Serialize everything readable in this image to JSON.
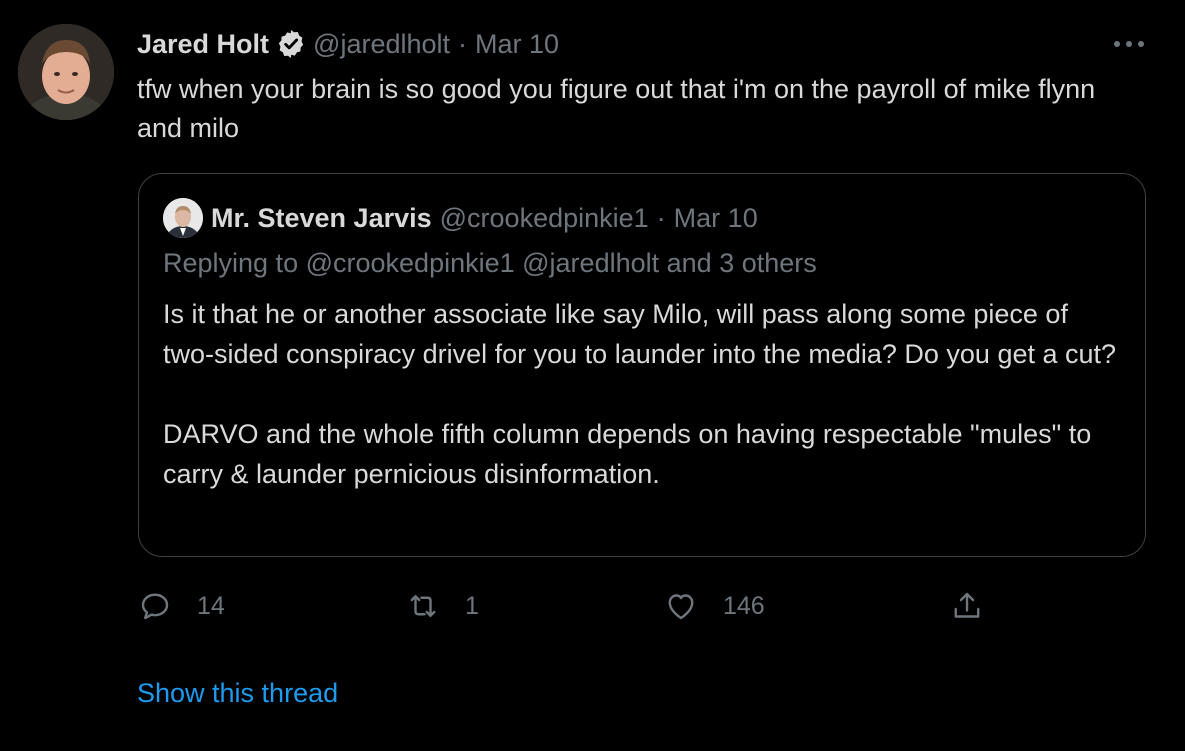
{
  "tweet": {
    "author": {
      "name": "Jared Holt",
      "handle": "@jaredlholt",
      "verified": true
    },
    "separator": "·",
    "date": "Mar 10",
    "text": "tfw when your brain is so good you figure out that i'm on the payroll of mike flynn and milo",
    "quoted": {
      "author": {
        "name": "Mr. Steven Jarvis",
        "handle": "@crookedpinkie1"
      },
      "separator": "·",
      "date": "Mar 10",
      "replying_prefix": "Replying to",
      "replying_to": "@crookedpinkie1 @jaredlholt",
      "replying_suffix": "and 3 others",
      "paragraphs": [
        "Is it that he or another associate like say Milo, will pass along some piece of two-sided conspiracy drivel for you to launder into the media? Do you get a cut?",
        "DARVO and the whole fifth column depends on having respectable \"mules\" to carry & launder pernicious disinformation."
      ]
    },
    "actions": {
      "reply_count": "14",
      "retweet_count": "1",
      "like_count": "146"
    },
    "show_thread": "Show this thread"
  },
  "icons": {
    "avatar": "avatar",
    "verified": "verified-badge-icon",
    "more": "more-horizontal-icon",
    "reply": "reply-icon",
    "retweet": "retweet-icon",
    "like": "heart-icon",
    "share": "share-icon"
  },
  "colors": {
    "background": "#000000",
    "text": "#d9d9d9",
    "secondary": "#6e767d",
    "link": "#1d9bf0",
    "border": "#3d4247"
  }
}
